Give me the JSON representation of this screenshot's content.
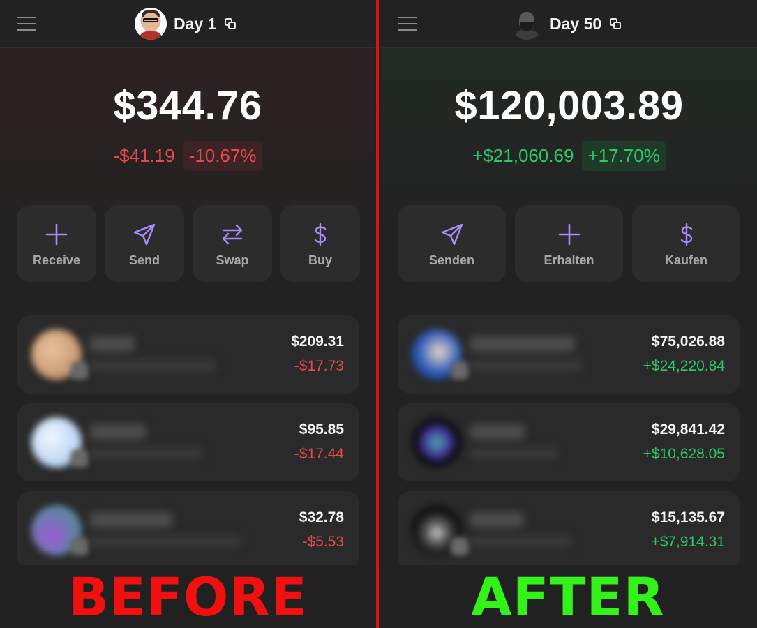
{
  "before": {
    "title": "Day 1",
    "balance": "$344.76",
    "change_amount": "-$41.19",
    "change_percent": "-10.67%",
    "actions": [
      {
        "label": "Receive",
        "icon": "plus-icon"
      },
      {
        "label": "Send",
        "icon": "send-icon"
      },
      {
        "label": "Swap",
        "icon": "swap-icon"
      },
      {
        "label": "Buy",
        "icon": "dollar-icon"
      }
    ],
    "assets": [
      {
        "value": "$209.31",
        "change": "-$17.73"
      },
      {
        "value": "$95.85",
        "change": "-$17.44"
      },
      {
        "value": "$32.78",
        "change": "-$5.53"
      }
    ],
    "caption": "BEFORE"
  },
  "after": {
    "title": "Day 50",
    "balance": "$120,003.89",
    "change_amount": "+$21,060.69",
    "change_percent": "+17.70%",
    "actions": [
      {
        "label": "Senden",
        "icon": "send-icon"
      },
      {
        "label": "Erhalten",
        "icon": "plus-icon"
      },
      {
        "label": "Kaufen",
        "icon": "dollar-icon"
      }
    ],
    "assets": [
      {
        "value": "$75,026.88",
        "change": "+$24,220.84"
      },
      {
        "value": "$29,841.42",
        "change": "+$10,628.05"
      },
      {
        "value": "$15,135.67",
        "change": "+$7,914.31"
      }
    ],
    "caption": "AFTER"
  },
  "colors": {
    "negative": "#e5484d",
    "positive": "#2ec866",
    "accent_icon": "#a78bfa",
    "divider": "#e11010",
    "caption_before": "#f01010",
    "caption_after": "#32f21a"
  }
}
